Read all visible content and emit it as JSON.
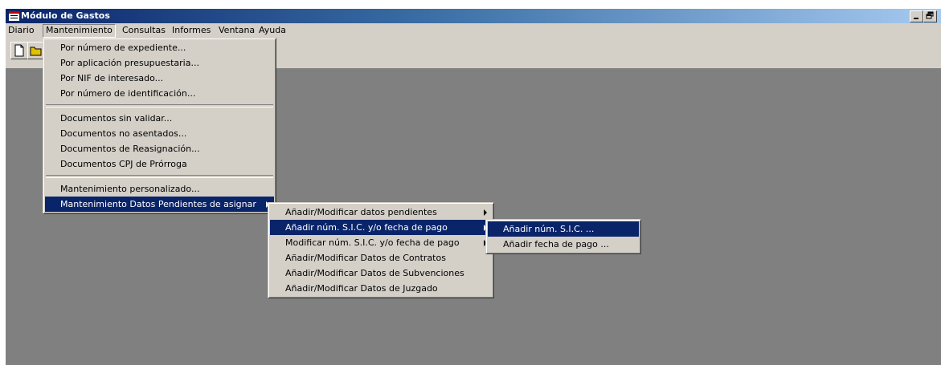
{
  "window": {
    "title": "Módulo de Gastos"
  },
  "menubar": {
    "items": [
      "Diario",
      "Mantenimiento",
      "Consultas",
      "Informes",
      "Ventana",
      "Ayuda"
    ]
  },
  "menu_mantenimiento": {
    "group1": [
      "Por número de expediente...",
      "Por aplicación presupuestaria...",
      "Por NIF de interesado...",
      "Por número de identificación..."
    ],
    "group2": [
      "Documentos sin validar...",
      "Documentos no asentados...",
      "Documentos de Reasignación...",
      "Documentos CPJ de Prórroga"
    ],
    "group3": [
      "Mantenimiento personalizado...",
      "Mantenimiento Datos Pendientes de asignar"
    ]
  },
  "submenu_pendientes": {
    "items": [
      "Añadir/Modificar datos pendientes",
      "Añadir núm. S.I.C. y/o fecha de pago",
      "Modificar núm. S.I.C. y/o fecha de pago",
      "Añadir/Modificar Datos de Contratos",
      "Añadir/Modificar Datos de Subvenciones",
      "Añadir/Modificar Datos de Juzgado"
    ]
  },
  "submenu_sic": {
    "items": [
      "Añadir núm. S.I.C. ...",
      "Añadir fecha de pago ..."
    ]
  },
  "colors": {
    "highlight": "#0a246a",
    "workspace": "#808080",
    "face": "#d4d0c8"
  },
  "icons": [
    "app-icon",
    "minimize-icon",
    "restore-icon",
    "new-document-icon",
    "open-folder-icon",
    "submenu-arrow-icon"
  ]
}
